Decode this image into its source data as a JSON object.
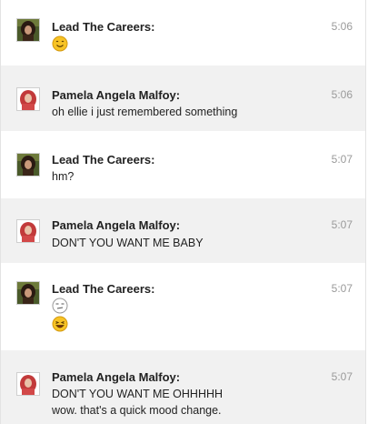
{
  "messages": [
    {
      "sender": "Lead The Careers:",
      "time": "5:06",
      "avatar": "brunette-portrait",
      "lines": [],
      "emoji": [
        "smiley-emoji"
      ]
    },
    {
      "sender": "Pamela Angela Malfoy:",
      "time": "5:06",
      "avatar": "red-portrait",
      "lines": [
        "oh ellie i just remembered something"
      ],
      "emoji": []
    },
    {
      "sender": "Lead The Careers:",
      "time": "5:07",
      "avatar": "brunette-portrait",
      "lines": [
        "hm?"
      ],
      "emoji": []
    },
    {
      "sender": "Pamela Angela Malfoy:",
      "time": "5:07",
      "avatar": "red-portrait",
      "lines": [
        "DON'T YOU WANT ME BABY"
      ],
      "emoji": []
    },
    {
      "sender": "Lead The Careers:",
      "time": "5:07",
      "avatar": "brunette-portrait",
      "lines": [],
      "emoji": [
        "meh-emoji",
        "laughing-emoji"
      ]
    },
    {
      "sender": "Pamela Angela Malfoy:",
      "time": "5:07",
      "avatar": "red-portrait",
      "lines": [
        "DON'T YOU WANT ME OHHHHH",
        "wow. that's a quick mood change."
      ],
      "emoji": []
    }
  ],
  "colors": {
    "row_grey": "#f1f1f1",
    "timestamp": "#9a9a9a",
    "emoji_yellow": "#f7c325"
  }
}
